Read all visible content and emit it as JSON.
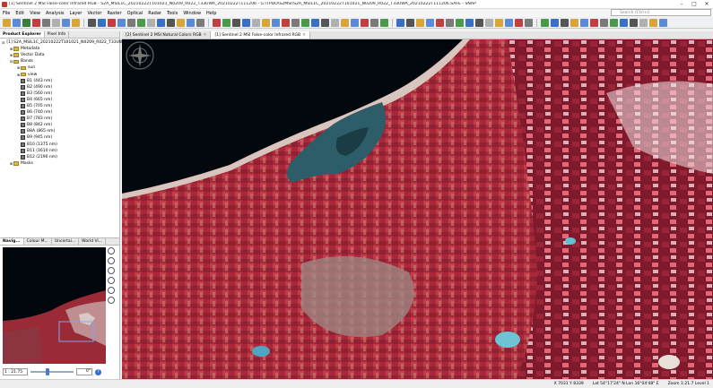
{
  "window": {
    "title": "[1] Sentinel 2 MSI False-color Infrared RGB - S2A_MSIL1C_20210222T101021_N0209_R022_T33UWA_20210222T111206 - G:\\TPDO\\S2MSI\\S2A_MSIL1C_20210222T101021_N0209_R022_T33UWA_20210222T111206.SAFE - SNAP",
    "minimize": "–",
    "maximize": "□",
    "close": "✕"
  },
  "menu": [
    "File",
    "Edit",
    "View",
    "Analysis",
    "Layer",
    "Vector",
    "Raster",
    "Optical",
    "Radar",
    "Tools",
    "Window",
    "Help"
  ],
  "search": {
    "placeholder": "Search (Ctrl+I)"
  },
  "left_panel": {
    "tabs": [
      "Product Explorer",
      "Pixel Info"
    ],
    "tree": [
      {
        "level": 0,
        "icon": "prod",
        "expander": "⊟",
        "label": "[1] S2A_MSIL1C_20210222T101021_N0209_R022_T33UWA"
      },
      {
        "level": 1,
        "icon": "folder",
        "expander": "⊞",
        "label": "Metadata"
      },
      {
        "level": 1,
        "icon": "folder",
        "expander": "⊞",
        "label": "Vector Data"
      },
      {
        "level": 1,
        "icon": "folder",
        "expander": "⊟",
        "label": "Bands"
      },
      {
        "level": 2,
        "icon": "folder",
        "expander": "⊞",
        "label": "sun"
      },
      {
        "level": 2,
        "icon": "folder",
        "expander": "⊞",
        "label": "view"
      },
      {
        "level": 2,
        "icon": "band",
        "expander": "",
        "label": "B1 (443 nm)"
      },
      {
        "level": 2,
        "icon": "band",
        "expander": "",
        "label": "B2 (490 nm)"
      },
      {
        "level": 2,
        "icon": "band",
        "expander": "",
        "label": "B3 (560 nm)"
      },
      {
        "level": 2,
        "icon": "band",
        "expander": "",
        "label": "B4 (665 nm)"
      },
      {
        "level": 2,
        "icon": "band",
        "expander": "",
        "label": "B5 (705 nm)"
      },
      {
        "level": 2,
        "icon": "band",
        "expander": "",
        "label": "B6 (740 nm)"
      },
      {
        "level": 2,
        "icon": "band",
        "expander": "",
        "label": "B7 (783 nm)"
      },
      {
        "level": 2,
        "icon": "band",
        "expander": "",
        "label": "B8 (842 nm)"
      },
      {
        "level": 2,
        "icon": "band",
        "expander": "",
        "label": "B8A (865 nm)"
      },
      {
        "level": 2,
        "icon": "band",
        "expander": "",
        "label": "B9 (945 nm)"
      },
      {
        "level": 2,
        "icon": "band",
        "expander": "",
        "label": "B10 (1375 nm)"
      },
      {
        "level": 2,
        "icon": "band",
        "expander": "",
        "label": "B11 (1610 nm)"
      },
      {
        "level": 2,
        "icon": "band",
        "expander": "",
        "label": "B12 (2190 nm)"
      },
      {
        "level": 1,
        "icon": "folder",
        "expander": "⊞",
        "label": "Masks"
      }
    ]
  },
  "nav_panel": {
    "tabs": [
      "Navig...",
      "Colour M...",
      "Uncertai...",
      "World Vi..."
    ],
    "zoom": "1 : 21.75",
    "rotation": "0°",
    "help": "?"
  },
  "doc_tabs": [
    {
      "label": "[2] Sentinel 2 MSI Natural Colors RGB",
      "active": false
    },
    {
      "label": "[1] Sentinel 2 MSI False-color Infrared RGB",
      "active": true
    }
  ],
  "status": {
    "xy": "X  7031  Y  8339",
    "latlon": "Lat 54°17'24\" N   Lon 16°04'48\" E",
    "zoom": "Zoom 1:21.7  Level 1"
  },
  "colors": {
    "vegetation": "#b3263a",
    "water": "#041020",
    "shallow_water": "#2e6c78",
    "bare": "#8a7a74"
  }
}
